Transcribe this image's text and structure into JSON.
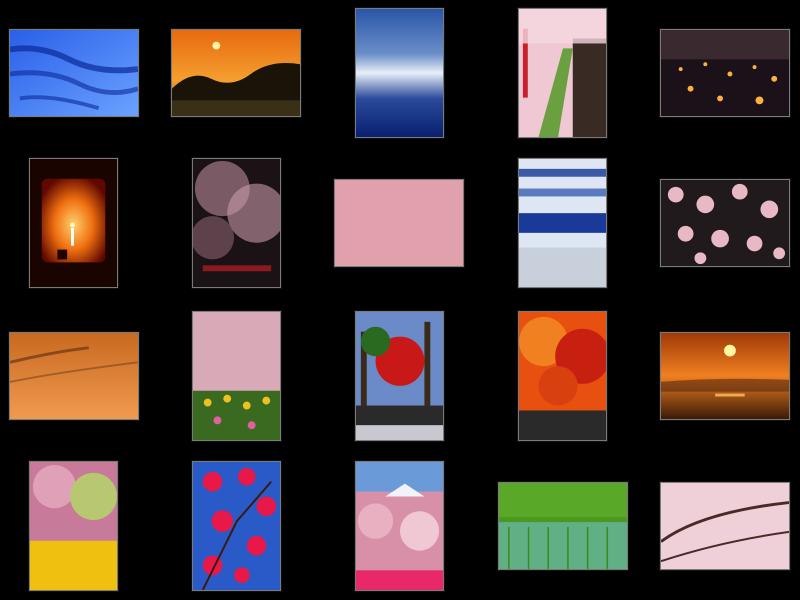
{
  "thumbnails": [
    {
      "subject": "snow-shadow"
    },
    {
      "subject": "sunset-village"
    },
    {
      "subject": "snow-closeup"
    },
    {
      "subject": "cherry-path"
    },
    {
      "subject": "lantern-night"
    },
    {
      "subject": "candle-window"
    },
    {
      "subject": "cherry-night"
    },
    {
      "subject": "petal-carpet"
    },
    {
      "subject": "snow-waves"
    },
    {
      "subject": "petals-dark"
    },
    {
      "subject": "snow-sunset"
    },
    {
      "subject": "cherry-tulips"
    },
    {
      "subject": "autumn-fence"
    },
    {
      "subject": "red-maple"
    },
    {
      "subject": "sunset-sea"
    },
    {
      "subject": "spring-blossom"
    },
    {
      "subject": "red-plum"
    },
    {
      "subject": "mountain-blossom"
    },
    {
      "subject": "rice-field"
    },
    {
      "subject": "cherry-canopy"
    }
  ]
}
